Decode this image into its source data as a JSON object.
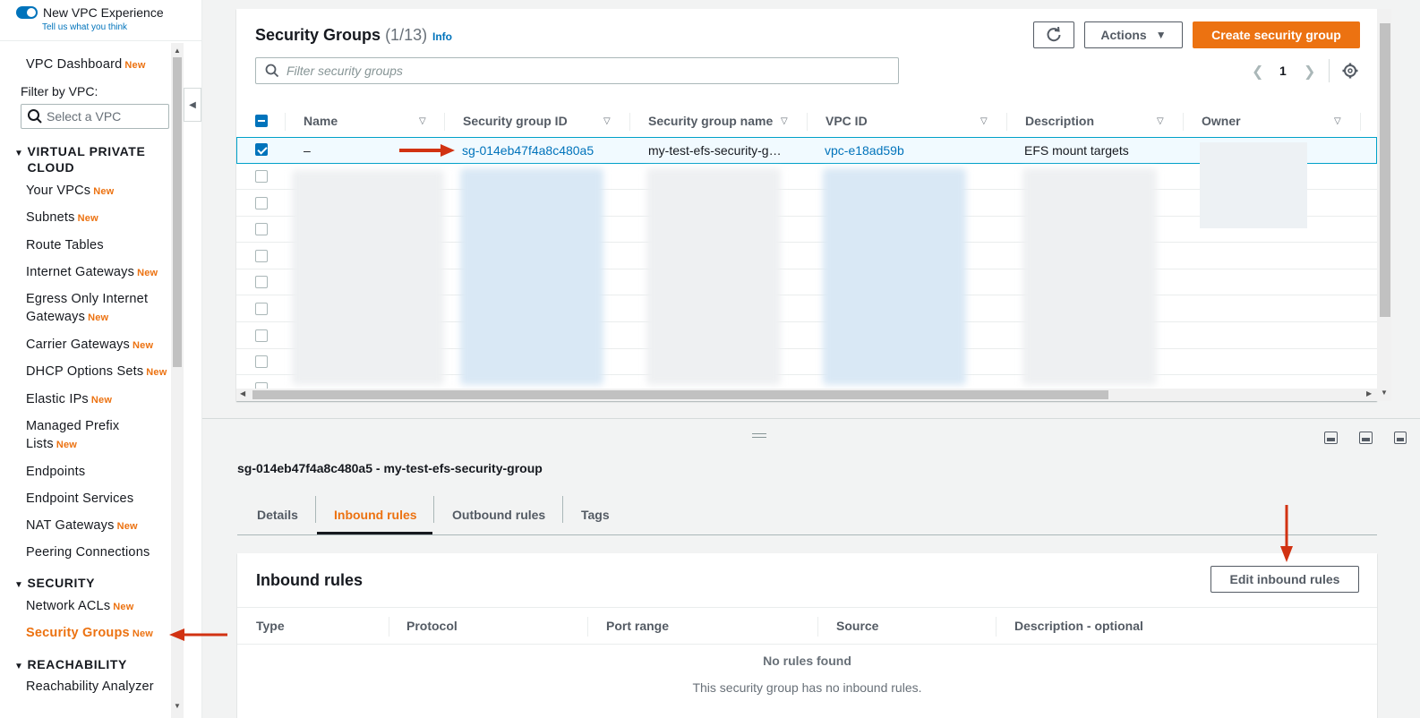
{
  "sidebar": {
    "new_vpc_label": "New VPC Experience",
    "feedback_link": "Tell us what you think",
    "dashboard": "VPC Dashboard",
    "new_badge": "New",
    "filter_label": "Filter by VPC:",
    "select_placeholder": "Select a VPC",
    "sections": {
      "vpc": "VIRTUAL PRIVATE CLOUD",
      "security": "SECURITY",
      "reachability": "REACHABILITY"
    },
    "items": {
      "your_vpcs": "Your VPCs",
      "subnets": "Subnets",
      "route_tables": "Route Tables",
      "internet_gateways": "Internet Gateways",
      "egress_1": "Egress Only Internet",
      "egress_2": "Gateways",
      "carrier_gateways": "Carrier Gateways",
      "dhcp": "DHCP Options Sets",
      "elastic_ips": "Elastic IPs",
      "prefix_1": "Managed Prefix",
      "prefix_2": "Lists",
      "endpoints": "Endpoints",
      "endpoint_services": "Endpoint Services",
      "nat": "NAT Gateways",
      "peering": "Peering Connections",
      "nacls": "Network ACLs",
      "security_groups": "Security Groups",
      "reachability_analyzer": "Reachability Analyzer"
    }
  },
  "top": {
    "title": "Security Groups",
    "count": "(1/13)",
    "info": "Info",
    "actions": "Actions",
    "create": "Create security group",
    "filter_placeholder": "Filter security groups",
    "page": "1",
    "columns": [
      "Name",
      "Security group ID",
      "Security group name",
      "VPC ID",
      "Description",
      "Owner"
    ],
    "selected_row": {
      "name": "–",
      "sg_id": "sg-014eb47f4a8c480a5",
      "sg_name": "my-test-efs-security-g…",
      "vpc_id": "vpc-e18ad59b",
      "description": "EFS mount targets"
    }
  },
  "detail": {
    "title": "sg-014eb47f4a8c480a5 - my-test-efs-security-group",
    "tabs": [
      "Details",
      "Inbound rules",
      "Outbound rules",
      "Tags"
    ],
    "panel_title": "Inbound rules",
    "edit_button": "Edit inbound rules",
    "columns": [
      "Type",
      "Protocol",
      "Port range",
      "Source",
      "Description - optional"
    ],
    "empty_title": "No rules found",
    "empty_sub": "This security group has no inbound rules."
  },
  "colors": {
    "accent": "#ec7211",
    "link": "#0073bb",
    "annotation": "#d13212"
  }
}
